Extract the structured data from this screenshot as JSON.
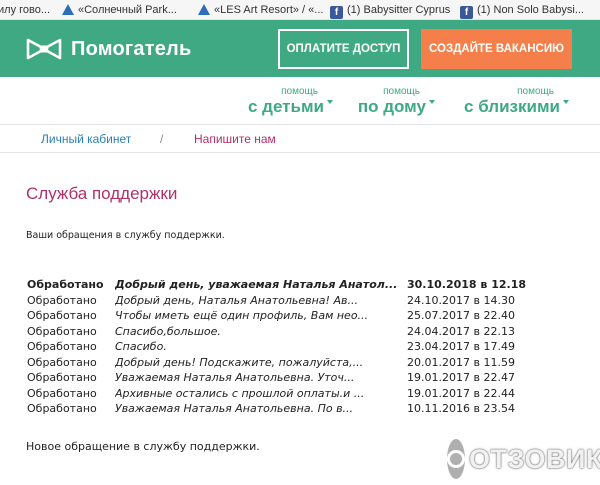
{
  "bookmarks": [
    {
      "icon": "site-icon",
      "label": "илу гово..."
    },
    {
      "icon": "triangle-icon",
      "label": "«Солнечный Park..."
    },
    {
      "icon": "triangle-icon",
      "label": "«LES Art Resort» / «..."
    },
    {
      "icon": "facebook-icon",
      "label": "(1) Babysitter Cyprus"
    },
    {
      "icon": "facebook-icon",
      "label": "(1) Non Solo Babysi..."
    }
  ],
  "header": {
    "logo_text": "Помогатель",
    "pay_button": "ОПЛАТИТЕ ДОСТУП",
    "create_button": "СОЗДАЙТЕ ВАКАНСИЮ",
    "accent_color": "#3ea983",
    "cta_color": "#f47f4a"
  },
  "help_nav": [
    {
      "small": "помощь",
      "big": "с детьми"
    },
    {
      "small": "помощь",
      "big": "по дому"
    },
    {
      "small": "помощь",
      "big": "с близкими"
    }
  ],
  "breadcrumbs": {
    "cabinet": "Личный кабинет",
    "separator": "/",
    "write": "Напишите нам"
  },
  "main": {
    "title": "Служба поддержки",
    "subtitle": "Ваши обращения в службу поддержки.",
    "new_ticket": "Новое обращение в службу поддержки."
  },
  "tickets": [
    {
      "status": "Обработано",
      "subject": "Добрый день, уважаемая Наталья Анатол...",
      "date": "30.10.2018 в 12.18"
    },
    {
      "status": "Обработано",
      "subject": "Добрый день, Наталья Анатольевна! Ав...",
      "date": "24.10.2017 в 14.30"
    },
    {
      "status": "Обработано",
      "subject": "Чтобы иметь ещё один профиль, Вам нео...",
      "date": "25.07.2017 в 22.40"
    },
    {
      "status": "Обработано",
      "subject": "Спасибо,большое.",
      "date": "24.04.2017 в 22.13"
    },
    {
      "status": "Обработано",
      "subject": "Спасибо.",
      "date": "23.04.2017 в 17.49"
    },
    {
      "status": "Обработано",
      "subject": "Добрый день! Подскажите, пожалуйста,...",
      "date": "20.01.2017 в 11.59"
    },
    {
      "status": "Обработано",
      "subject": "Уважаемая Наталья Анатольевна. Уточ...",
      "date": "19.01.2017 в 22.47"
    },
    {
      "status": "Обработано",
      "subject": "Архивные остались с прошлой оплаты.и ...",
      "date": "19.01.2017 в 22.44"
    },
    {
      "status": "Обработано",
      "subject": "Уважаемая Наталья Анатольевна. По в...",
      "date": "10.11.2016 в 23.54"
    }
  ],
  "watermark": "ОТЗОВИК"
}
